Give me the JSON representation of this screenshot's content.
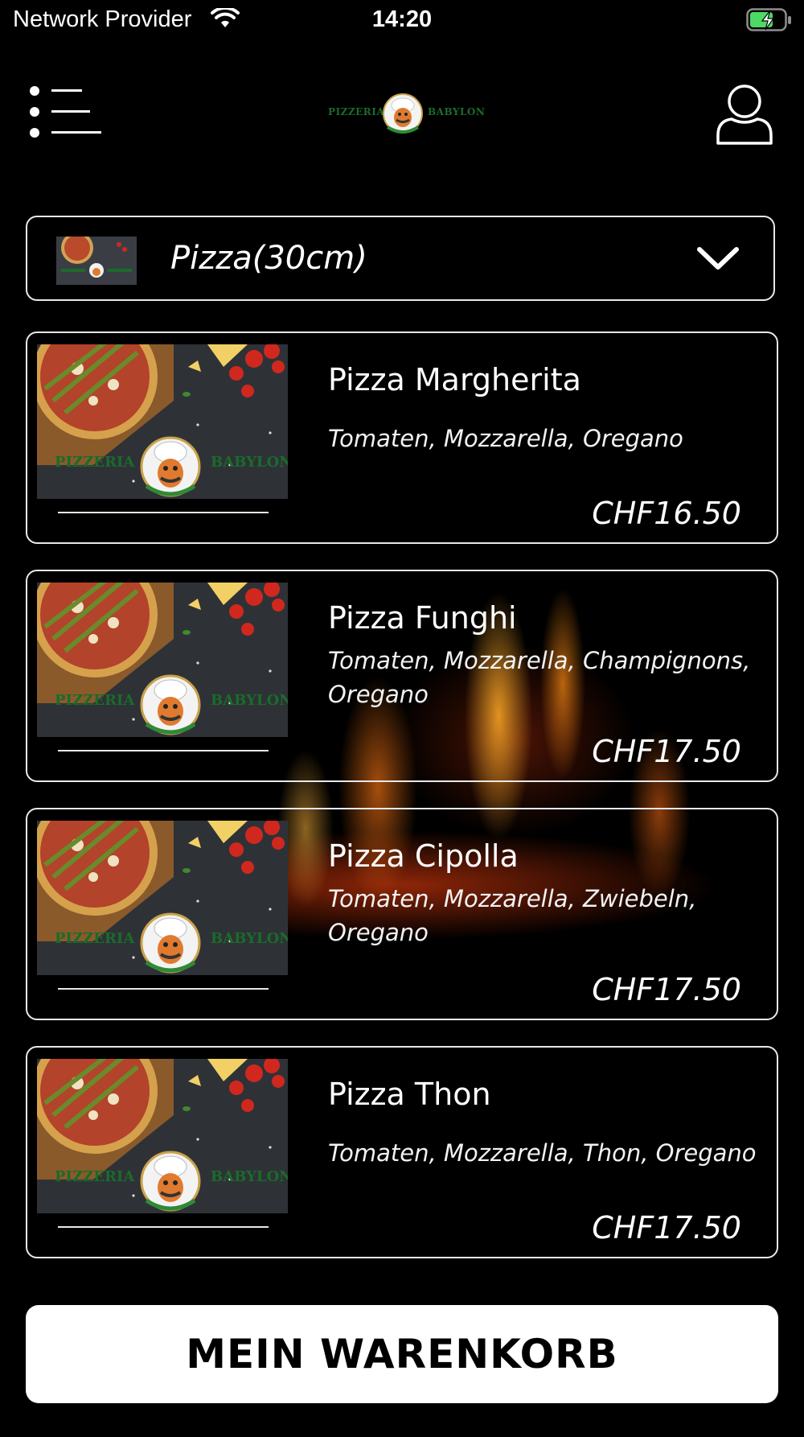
{
  "status_bar": {
    "carrier": "Network Provider",
    "time": "14:20",
    "icons": [
      "wifi-icon",
      "battery-charging-icon"
    ]
  },
  "header": {
    "logo_left": "PIZZERIA",
    "logo_right": "BABYLON",
    "menu_icon": "list-menu-icon",
    "profile_icon": "user-profile-icon"
  },
  "category": {
    "selected": "Pizza(30cm)",
    "dropdown_icon": "chevron-down-icon"
  },
  "products": [
    {
      "name": "Pizza Margherita",
      "description": "Tomaten, Mozzarella, Oregano",
      "price": "CHF16.50"
    },
    {
      "name": "Pizza Funghi",
      "description": "Tomaten, Mozzarella, Champignons, Oregano",
      "price": "CHF17.50"
    },
    {
      "name": "Pizza Cipolla",
      "description": "Tomaten, Mozzarella, Zwiebeln, Oregano",
      "price": "CHF17.50"
    },
    {
      "name": "Pizza Thon",
      "description": "Tomaten, Mozzarella, Thon, Oregano",
      "price": "CHF17.50"
    }
  ],
  "product_photo_text": {
    "left": "PIZZERIA",
    "right": "BABYLON"
  },
  "cart": {
    "label": "MEIN WARENKORB"
  },
  "colors": {
    "background": "#000000",
    "border": "#e8e8e8",
    "brand_green": "#1b6b2a",
    "battery_green": "#4cd964"
  }
}
